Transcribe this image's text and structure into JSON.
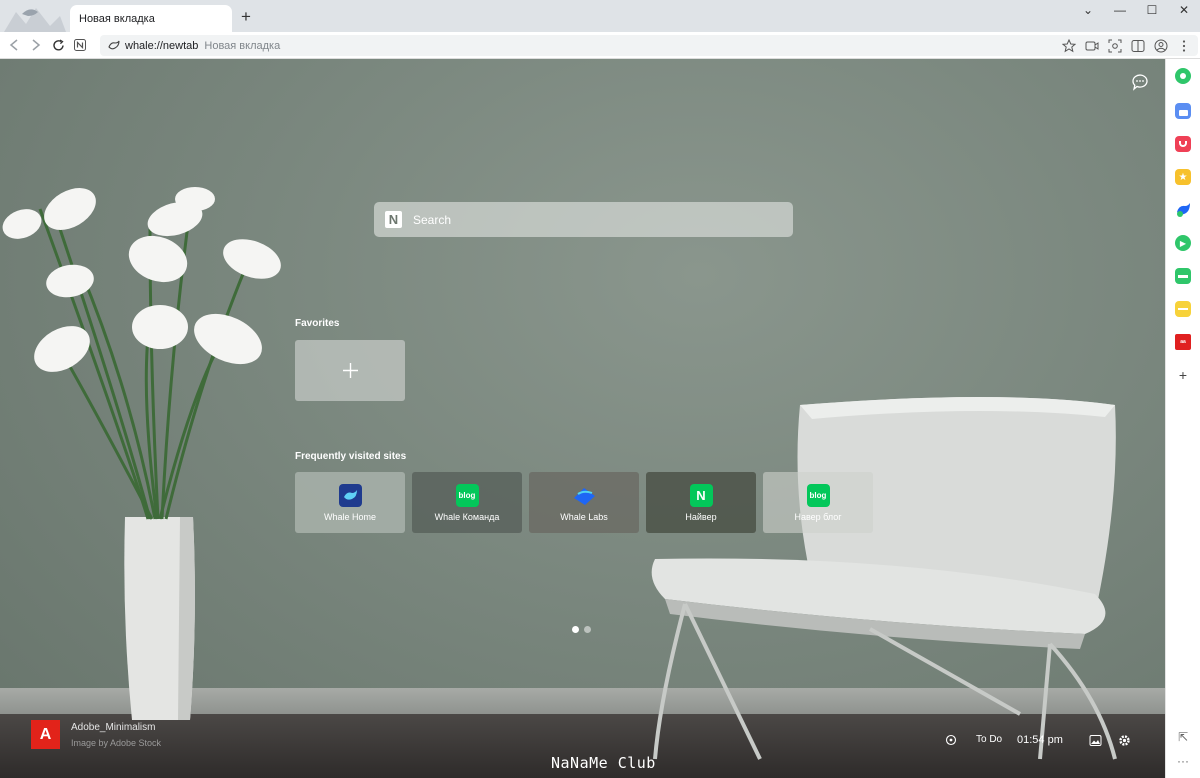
{
  "tab": {
    "title": "Новая вкладка",
    "new_tab_symbol": "+"
  },
  "window_controls": {
    "chevron": "⌄",
    "minimize": "—",
    "maximize": "☐",
    "close": "✕"
  },
  "address_bar": {
    "url": "whale://newtab",
    "page_title": "Новая вкладка"
  },
  "newtab": {
    "search_placeholder": "Search",
    "search_logo": "N",
    "favorites_title": "Favorites",
    "frequent_title": "Frequently visited sites",
    "frequent_sites": [
      {
        "label": "Whale Home",
        "icon": "whale-icon",
        "tile_color": "#9ea8a1"
      },
      {
        "label": "Whale Команда",
        "icon": "blog-icon",
        "icon_text": "blog",
        "tile_color": "#5c655e"
      },
      {
        "label": "Whale Labs",
        "icon": "whale-labs-icon",
        "tile_color": "#6e6c66"
      },
      {
        "label": "Найвер",
        "icon": "naver-icon",
        "icon_text": "N",
        "tile_color": "#4d5148"
      },
      {
        "label": "Навер блог",
        "icon": "blog-icon",
        "icon_text": "blog",
        "tile_color": "#b9bdb8"
      }
    ],
    "background": {
      "name": "Adobe_Minimalism",
      "credit": "Image by Adobe Stock",
      "logo_letter": "A"
    },
    "watermark": "NaNaMe Club",
    "todo_label": "To Do",
    "clock": "01:54 pm"
  },
  "sidebar_icons": [
    "green-circle-icon",
    "calendar-icon",
    "pocket-icon",
    "star-icon",
    "whale-translate-icon",
    "play-icon",
    "green-app-icon",
    "note-icon",
    "red-app-icon",
    "add-icon"
  ],
  "sidebar_bottom": {
    "open_new_symbol": "⇱",
    "more_symbol": "···"
  },
  "colors": {
    "accent_green": "#03c75a",
    "adobe_red": "#e2231a",
    "whale_blue": "#1e66f5"
  }
}
